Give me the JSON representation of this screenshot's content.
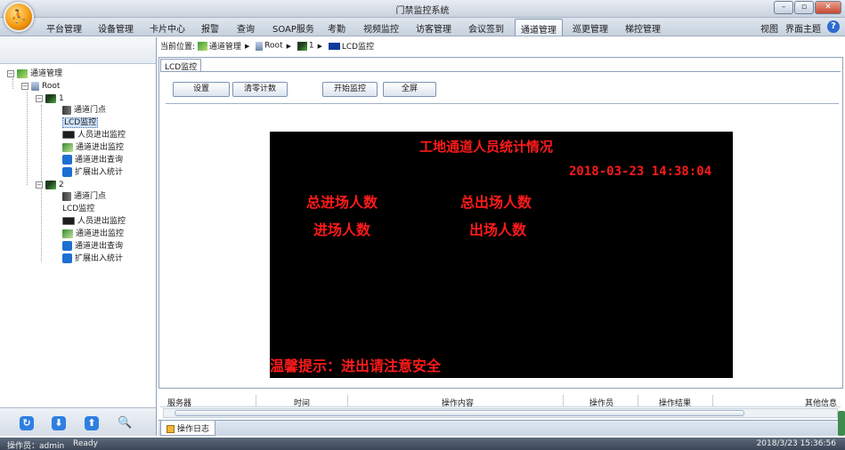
{
  "window": {
    "title": "门禁监控系统",
    "controls": [
      "–",
      "▫",
      "✕"
    ]
  },
  "logo": {
    "glyph": "⛹"
  },
  "menu": {
    "items": [
      "平台管理",
      "设备管理",
      "卡片中心",
      "报警",
      "查询",
      "SOAP服务",
      "考勤",
      "视频监控",
      "访客管理",
      "会议签到",
      "通道管理",
      "巡更管理",
      "梯控管理"
    ],
    "active": "通道管理",
    "right_items": [
      "视图",
      "界面主题"
    ],
    "help": "?"
  },
  "tree": {
    "root_label": "通道管理",
    "root_child": "Root",
    "groups": [
      {
        "label": "1",
        "items": [
          "通道门点",
          "LCD监控",
          "人员进出监控",
          "通道进出监控",
          "通道进出查询",
          "扩展出入统计"
        ]
      },
      {
        "label": "2",
        "items": [
          "通道门点",
          "LCD监控",
          "人员进出监控",
          "通道进出监控",
          "通道进出查询",
          "扩展出入统计"
        ]
      }
    ],
    "selected": "LCD监控"
  },
  "left_toolbar": {
    "buttons": [
      "↻",
      "⬇",
      "⬆",
      "🔍"
    ]
  },
  "breadcrumb": {
    "prefix": "当前位置:",
    "parts": [
      "通道管理",
      "Root",
      "1",
      "LCD监控"
    ],
    "separator": "▶"
  },
  "tab": {
    "label": "LCD监控"
  },
  "toolbar": {
    "settings": "设置",
    "reset_count": "清零计数",
    "start_monitor": "开始监控",
    "fullscreen": "全屏"
  },
  "lcd": {
    "title": "工地通道人员统计情况",
    "datetime": "2018-03-23 14:38:04",
    "total_in_label": "总进场人数",
    "total_out_label": "总出场人数",
    "in_label": "进场人数",
    "out_label": "出场人数",
    "tip": "温馨提示：进出请注意安全",
    "text_color": "#ff1a1a",
    "background": "#000000"
  },
  "log": {
    "columns": [
      "服务器",
      "时间",
      "操作内容",
      "操作员",
      "操作结果",
      "其他信息"
    ],
    "tab_label": "操作日志"
  },
  "status": {
    "operator": "操作员：admin",
    "state": "Ready",
    "datetime": "2018/3/23 15:36:56"
  }
}
